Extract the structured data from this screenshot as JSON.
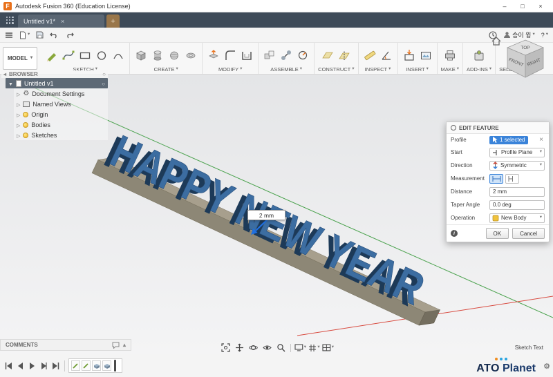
{
  "window": {
    "logo_letter": "F",
    "title": "Autodesk Fusion 360 (Education License)"
  },
  "tabs": {
    "active": "Untitled v1*"
  },
  "account": {
    "user": "승이 윙",
    "help": "?"
  },
  "workspace": {
    "label": "MODEL"
  },
  "toolbar": {
    "groups": [
      {
        "label": "SKETCH"
      },
      {
        "label": "CREATE"
      },
      {
        "label": "MODIFY"
      },
      {
        "label": "ASSEMBLE"
      },
      {
        "label": "CONSTRUCT"
      },
      {
        "label": "INSPECT"
      },
      {
        "label": "INSERT"
      },
      {
        "label": "MAKE"
      },
      {
        "label": "ADD-INS"
      },
      {
        "label": "SELECT"
      }
    ]
  },
  "browser": {
    "header": "BROWSER",
    "root": {
      "label": "Untitled v1"
    },
    "items": [
      {
        "label": "Document Settings"
      },
      {
        "label": "Named Views"
      },
      {
        "label": "Origin"
      },
      {
        "label": "Bodies"
      },
      {
        "label": "Sketches"
      }
    ]
  },
  "viewcube": {
    "faces": [
      "TOP",
      "FRONT",
      "RIGHT"
    ]
  },
  "canvas": {
    "model_text": "HAPPY NEW YEAR",
    "distance_label": "2 mm"
  },
  "edit_feature": {
    "title": "EDIT FEATURE",
    "profile": {
      "label": "Profile",
      "value": "1 selected"
    },
    "start": {
      "label": "Start",
      "value": "Profile Plane"
    },
    "direction": {
      "label": "Direction",
      "value": "Symmetric"
    },
    "measurement": {
      "label": "Measurement"
    },
    "distance": {
      "label": "Distance",
      "value": "2 mm"
    },
    "taper": {
      "label": "Taper Angle",
      "value": "0.0 deg"
    },
    "operation": {
      "label": "Operation",
      "value": "New Body"
    },
    "ok_label": "OK",
    "cancel_label": "Cancel"
  },
  "comments": {
    "label": "COMMENTS"
  },
  "footer": {
    "tool_hint": "Sketch Text"
  },
  "brand": {
    "name_left": "ATO",
    "name_right": "Planet"
  },
  "colors": {
    "accent_blue": "#0696d7",
    "badge_blue": "#3a83d9",
    "model_blue": "#3c6da1",
    "axis_green": "#4aa24d",
    "axis_red": "#d84a3f"
  }
}
